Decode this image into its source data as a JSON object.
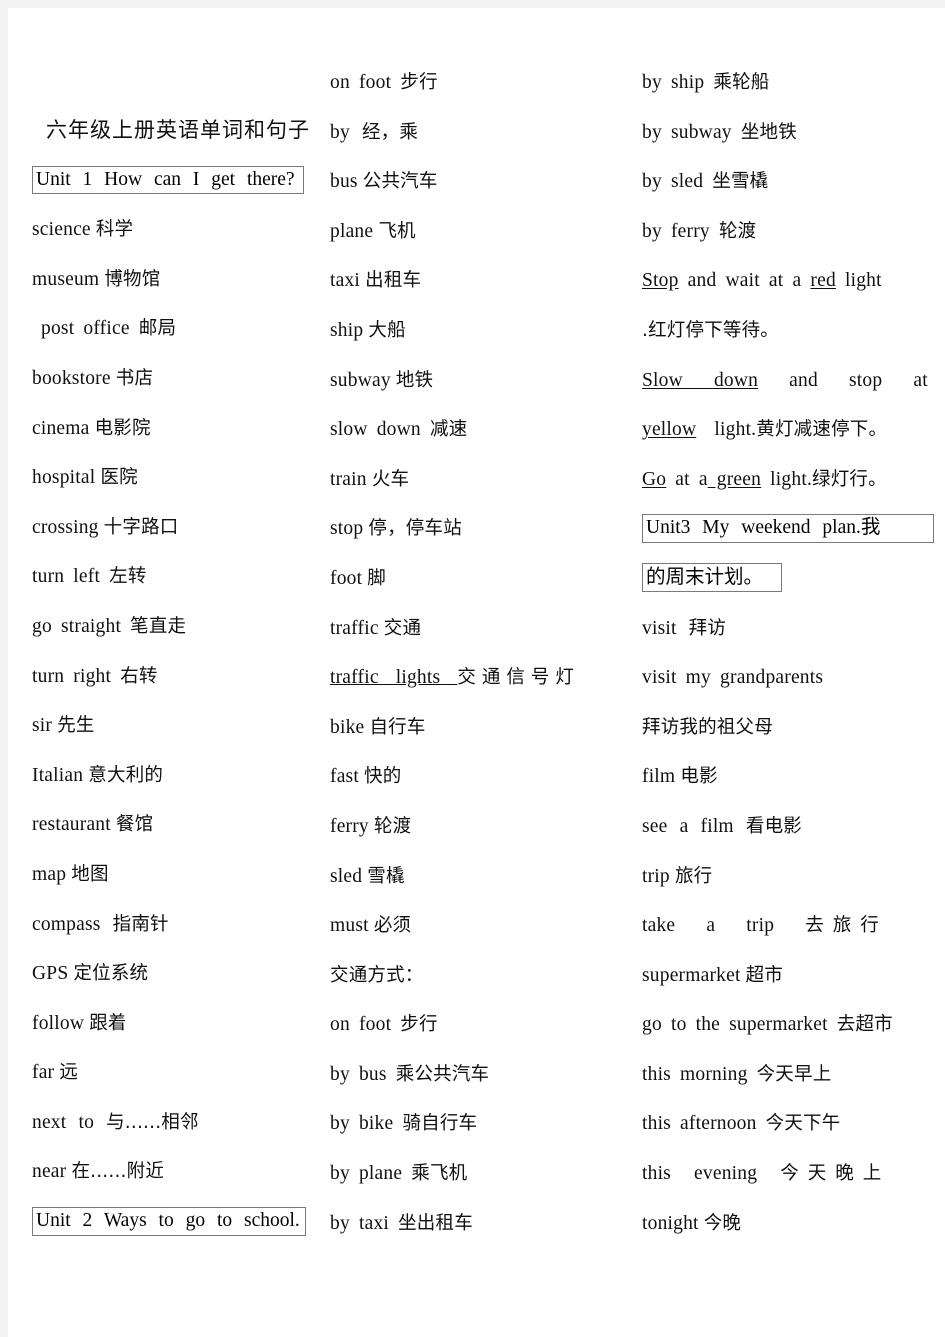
{
  "document": {
    "title": "六年级上册英语单词和句子",
    "page_background": "#ffffff",
    "frame_color": "#f4f4f4",
    "text_color": "#101010",
    "box_border_color": "#7a7a7a"
  },
  "column1": {
    "title": "六年级上册英语单词和句子",
    "unit_heading": "Unit 1    How can I get there?",
    "entries": [
      {
        "en": "science",
        "cn": "科学"
      },
      {
        "en": "museum",
        "cn": "博物馆"
      },
      {
        "en": "post office",
        "cn": "邮局"
      },
      {
        "en": "bookstore",
        "cn": "书店"
      },
      {
        "en": "cinema",
        "cn": "电影院"
      },
      {
        "en": "hospital",
        "cn": "医院"
      },
      {
        "en": "crossing",
        "cn": "十字路口"
      },
      {
        "en": "turn left",
        "cn": "左转"
      },
      {
        "en": "go straight",
        "cn": "笔直走"
      },
      {
        "en": "turn right",
        "cn": "右转"
      },
      {
        "en": "sir",
        "cn": "先生"
      },
      {
        "en": "Italian",
        "cn": "意大利的"
      },
      {
        "en": "restaurant",
        "cn": "餐馆"
      },
      {
        "en": "map",
        "cn": "地图"
      },
      {
        "en": "compass",
        "cn": "指南针"
      },
      {
        "en": "GPS",
        "cn": "定位系统"
      },
      {
        "en": "follow",
        "cn": "跟着"
      },
      {
        "en": "far",
        "cn": "远"
      },
      {
        "en": "next to",
        "cn": "与......相邻"
      },
      {
        "en": "near",
        "cn": "在......附近"
      }
    ],
    "unit2_heading": "Unit 2    Ways to go to school."
  },
  "column2": {
    "entries": [
      {
        "en": "on foot",
        "cn": "步行"
      },
      {
        "en": "by",
        "cn": "经，乘"
      },
      {
        "en": "bus",
        "cn": "公共汽车"
      },
      {
        "en": "plane",
        "cn": "飞机"
      },
      {
        "en": "taxi",
        "cn": "出租车"
      },
      {
        "en": "ship",
        "cn": "大船"
      },
      {
        "en": "subway",
        "cn": "地铁"
      },
      {
        "en": "slow down",
        "cn": "减速"
      },
      {
        "en": "train",
        "cn": "火车"
      },
      {
        "en": "stop",
        "cn": "停，停车站"
      },
      {
        "en": "foot",
        "cn": "脚"
      },
      {
        "en": "traffic",
        "cn": "交通"
      },
      {
        "en": "traffic lights",
        "cn": "交通信号灯"
      },
      {
        "en": "bike",
        "cn": "自行车"
      },
      {
        "en": "fast",
        "cn": "快的"
      },
      {
        "en": "ferry",
        "cn": "轮渡"
      },
      {
        "en": "sled",
        "cn": "雪橇"
      },
      {
        "en": "must",
        "cn": "必须"
      }
    ],
    "section_label": "交通方式：",
    "ways": [
      {
        "en": "on foot",
        "cn": "步行"
      },
      {
        "en": "by bus",
        "cn": "乘公共汽车"
      },
      {
        "en": "by bike",
        "cn": "骑自行车"
      },
      {
        "en": "by plane",
        "cn": "乘飞机"
      },
      {
        "en": "by taxi",
        "cn": "坐出租车"
      }
    ]
  },
  "column3": {
    "ways": [
      {
        "en": "by ship",
        "cn": "乘轮船"
      },
      {
        "en": "by subway",
        "cn": "坐地铁"
      },
      {
        "en": "by sled",
        "cn": "坐雪橇"
      },
      {
        "en": "by ferry",
        "cn": "轮渡"
      }
    ],
    "sentences": [
      {
        "en_parts": [
          "Stop",
          " and wait at a ",
          "red",
          " light"
        ],
        "underlined": [
          true,
          false,
          true,
          false
        ],
        "cn": ".红灯停下等待。"
      },
      {
        "en_parts": [
          "Slow down",
          " and stop at a ",
          "yellow",
          " light."
        ],
        "underlined": [
          true,
          false,
          true,
          false
        ],
        "cn": "黄灯减速停下。"
      },
      {
        "en_parts": [
          "Go",
          " at a ",
          "green",
          " light."
        ],
        "underlined": [
          true,
          false,
          true,
          false
        ],
        "cn": "绿灯行。"
      }
    ],
    "unit3_heading_line1": "Unit3    My weekend plan.我",
    "unit3_heading_line2": "的周末计划。",
    "entries": [
      {
        "en": "visit",
        "cn": "拜访"
      },
      {
        "en": "visit my grandparents",
        "cn": ""
      },
      {
        "en": "",
        "cn": "拜访我的祖父母"
      },
      {
        "en": "film",
        "cn": "电影"
      },
      {
        "en": "see a film",
        "cn": "看电影"
      },
      {
        "en": "trip",
        "cn": "旅行"
      },
      {
        "en": "take a trip",
        "cn": "去旅行"
      },
      {
        "en": "supermarket",
        "cn": "超市"
      },
      {
        "en": "go to the supermarket",
        "cn": "去超市"
      },
      {
        "en": "this morning",
        "cn": "今天早上"
      },
      {
        "en": "this afternoon",
        "cn": "今天下午"
      },
      {
        "en": "this evening",
        "cn": "今天晚上"
      },
      {
        "en": "tonight",
        "cn": "今晚"
      }
    ]
  }
}
